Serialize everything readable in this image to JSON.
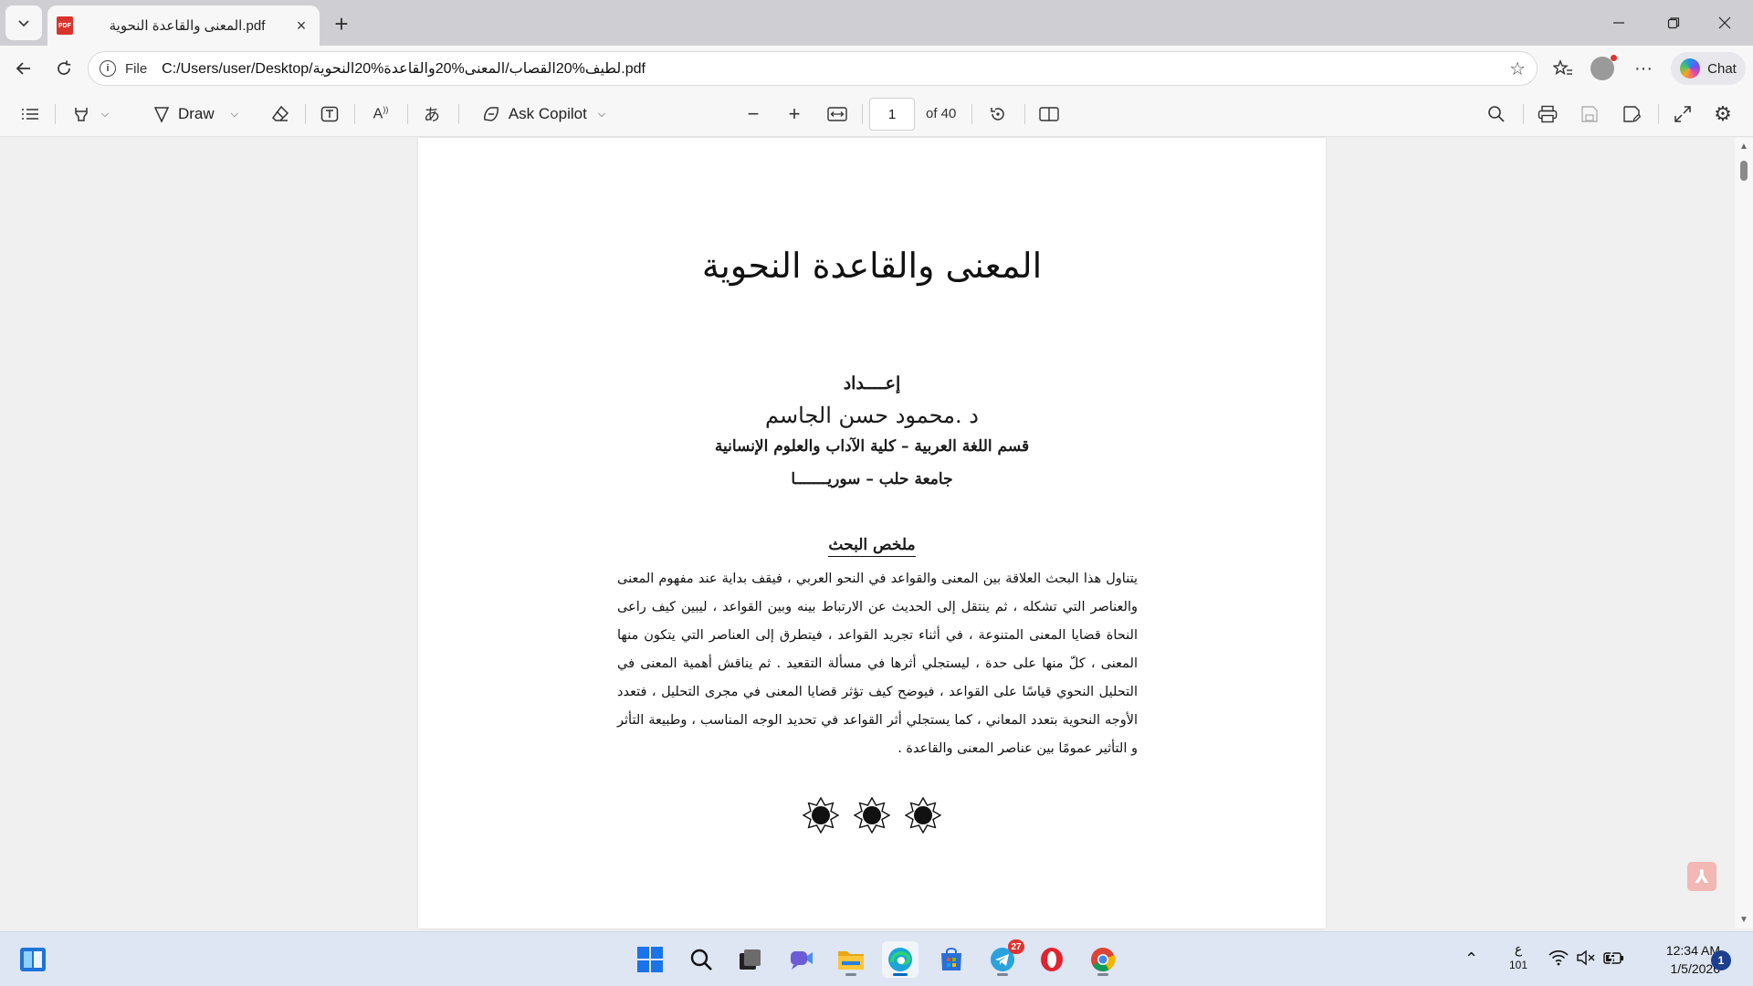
{
  "browser": {
    "tab_title": "المعنى والقاعدة النحوية.pdf",
    "tab_favicon_text": "PDF",
    "new_tab_label": "+",
    "address_scheme": "File",
    "url": "C:/Users/user/Desktop/لطيف%20القصاب/المعنى%20والقاعدة%20النحوية.pdf",
    "chat_label": "Chat"
  },
  "pdf_toolbar": {
    "draw_label": "Draw",
    "ask_copilot_label": "Ask Copilot",
    "page_current": "1",
    "page_total_label": "of 40"
  },
  "document": {
    "title": "المعنى والقاعدة النحوية",
    "prepared_by": "إعــــداد",
    "author": "د .محمود حسن الجاسم",
    "department": "قسم اللغة العربية – كلية الآداب والعلوم الإنسانية",
    "university": "جامعة حلب – سوريـــــــا",
    "abstract_heading": "ملخص البحث",
    "abstract_body": "يتناول هذا البحث العلاقة بين المعنى والقواعد في النحو العربي ، فيقف بداية عند مفهوم المعنى والعناصر التي تشكله ، ثم ينتقل إلى الحديث عن الارتباط بينه وبين القواعد ، ليبين كيف راعى النحاة قضايا المعنى المتنوعة ، في أثناء تجريد القواعد ، فيتطرق إلى العناصر التي يتكون منها المعنى ، كلّ منها على حدة ، ليستجلي أثرها في مسألة التقعيد . ثم يناقش أهمية المعنى في التحليل النحوي قياسًا على القواعد ، فيوضح كيف تؤثر قضايا المعنى في مجرى التحليل ، فتعدد الأوجه النحوية بتعدد المعاني ، كما يستجلي أثر القواعد في تحديد الوجه المناسب ، وطبيعة التأثر و التأثير عمومًا بين عناصر المعنى والقاعدة ."
  },
  "taskbar": {
    "language_indicator": "ع",
    "language_sub": "101",
    "time": "12:34 AM",
    "date": "1/5/2026",
    "notification_count": "1",
    "telegram_badge": "27"
  },
  "colors": {
    "accent": "#0067c0",
    "pdf_red": "#d9342b"
  }
}
